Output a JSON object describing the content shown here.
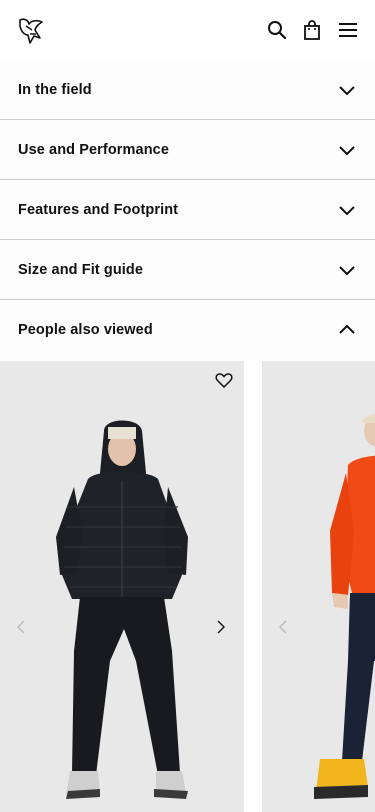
{
  "header": {
    "logo_icon": "norrona-logo-icon",
    "search_icon": "search-icon",
    "bag_icon": "shopping-bag-icon",
    "menu_icon": "hamburger-menu-icon"
  },
  "accordion": [
    {
      "label": "In the field",
      "state": "collapsed"
    },
    {
      "label": "Use and Performance",
      "state": "collapsed"
    },
    {
      "label": "Features and Footprint",
      "state": "collapsed"
    },
    {
      "label": "Size and Fit guide",
      "state": "collapsed"
    },
    {
      "label": "People also viewed",
      "state": "expanded"
    }
  ],
  "products": [
    {
      "image": "person wearing black hooded down jacket and black pants",
      "jacket_color": "#1f2228",
      "favorite_icon": "heart-outline-icon"
    },
    {
      "image": "person wearing orange fleece jacket and navy pants",
      "jacket_color": "#f04a16"
    }
  ],
  "colors": {
    "divider": "#cfcfcf",
    "card_bg": "#e8e8e8",
    "text": "#111111"
  }
}
